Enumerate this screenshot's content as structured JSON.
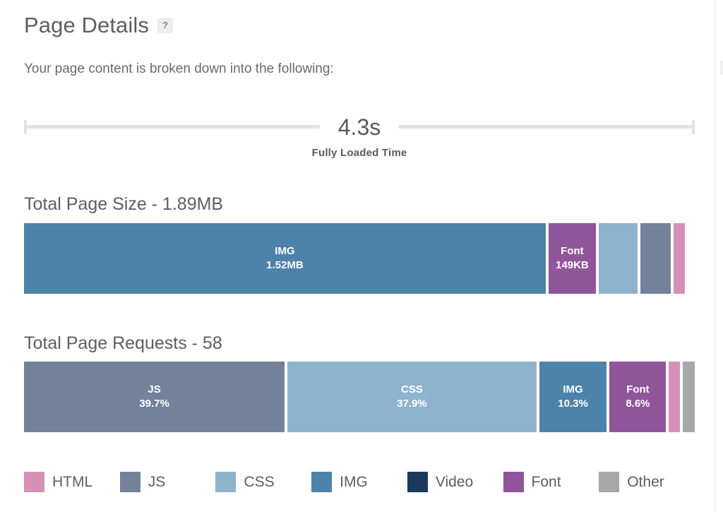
{
  "header": {
    "title": "Page Details",
    "help_icon": "?",
    "subtitle": "Your page content is broken down into the following:"
  },
  "timeline": {
    "value": "4.3s",
    "label": "Fully Loaded Time"
  },
  "colors": {
    "html": "#d690b7",
    "js": "#73829a",
    "css": "#8fb3cc",
    "img": "#4d82aa",
    "video": "#1a3a5c",
    "font": "#91559b",
    "other": "#a8a8a8",
    "text": "#5e5e5e",
    "rule": "#e3e3e3"
  },
  "sections": [
    {
      "id": "total-page-size",
      "title": "Total Page Size - 1.89MB"
    },
    {
      "id": "total-page-requests",
      "title": "Total Page Requests - 58"
    }
  ],
  "legend": {
    "items": [
      {
        "key": "html",
        "label": "HTML"
      },
      {
        "key": "js",
        "label": "JS"
      },
      {
        "key": "css",
        "label": "CSS"
      },
      {
        "key": "img",
        "label": "IMG"
      },
      {
        "key": "video",
        "label": "Video"
      },
      {
        "key": "font",
        "label": "Font"
      },
      {
        "key": "other",
        "label": "Other"
      }
    ]
  },
  "chart_data": [
    {
      "type": "bar",
      "id": "total-page-size",
      "title": "Total Page Size - 1.89MB",
      "orientation": "horizontal-stacked",
      "total": "1.89MB",
      "total_value": 1.89,
      "unit": "MB",
      "categories": [
        "IMG",
        "Font",
        "CSS",
        "JS",
        "HTML"
      ],
      "values": [
        1.52,
        0.149,
        0.0595,
        0.0455,
        0.0165
      ],
      "segments": [
        {
          "key": "img",
          "label": "IMG",
          "value": "1.52MB",
          "width_pct": 79.1,
          "show_label": true,
          "color": "#4d82aa"
        },
        {
          "key": "font",
          "label": "Font",
          "value": "149KB",
          "width_pct": 7.2,
          "show_label": true,
          "color": "#91559b"
        },
        {
          "key": "css",
          "label": "CSS",
          "value": "",
          "width_pct": 5.9,
          "show_label": false,
          "color": "#8fb3cc"
        },
        {
          "key": "js",
          "label": "JS",
          "value": "",
          "width_pct": 4.6,
          "show_label": false,
          "color": "#73829a"
        },
        {
          "key": "html",
          "label": "HTML",
          "value": "",
          "width_pct": 1.7,
          "show_label": false,
          "color": "#d690b7"
        }
      ],
      "legend": [
        "HTML",
        "JS",
        "CSS",
        "IMG",
        "Video",
        "Font",
        "Other"
      ]
    },
    {
      "type": "bar",
      "id": "total-page-requests",
      "title": "Total Page Requests - 58",
      "orientation": "horizontal-stacked",
      "total": "58",
      "total_value": 58,
      "unit": "requests",
      "categories": [
        "JS",
        "CSS",
        "IMG",
        "Font",
        "HTML",
        "Other"
      ],
      "values": [
        39.7,
        37.9,
        10.3,
        8.6,
        1.7,
        1.7
      ],
      "segments": [
        {
          "key": "js",
          "label": "JS",
          "value": "39.7%",
          "width_pct": 39.7,
          "show_label": true,
          "color": "#73829a"
        },
        {
          "key": "css",
          "label": "CSS",
          "value": "37.9%",
          "width_pct": 37.9,
          "show_label": true,
          "color": "#8fb3cc"
        },
        {
          "key": "img",
          "label": "IMG",
          "value": "10.3%",
          "width_pct": 10.3,
          "show_label": true,
          "color": "#4d82aa"
        },
        {
          "key": "font",
          "label": "Font",
          "value": "8.6%",
          "width_pct": 8.6,
          "show_label": true,
          "color": "#91559b"
        },
        {
          "key": "html",
          "label": "HTML",
          "value": "",
          "width_pct": 1.7,
          "show_label": false,
          "color": "#d690b7"
        },
        {
          "key": "other",
          "label": "Other",
          "value": "",
          "width_pct": 1.8,
          "show_label": false,
          "color": "#a8a8a8"
        }
      ],
      "legend": [
        "HTML",
        "JS",
        "CSS",
        "IMG",
        "Video",
        "Font",
        "Other"
      ]
    }
  ]
}
